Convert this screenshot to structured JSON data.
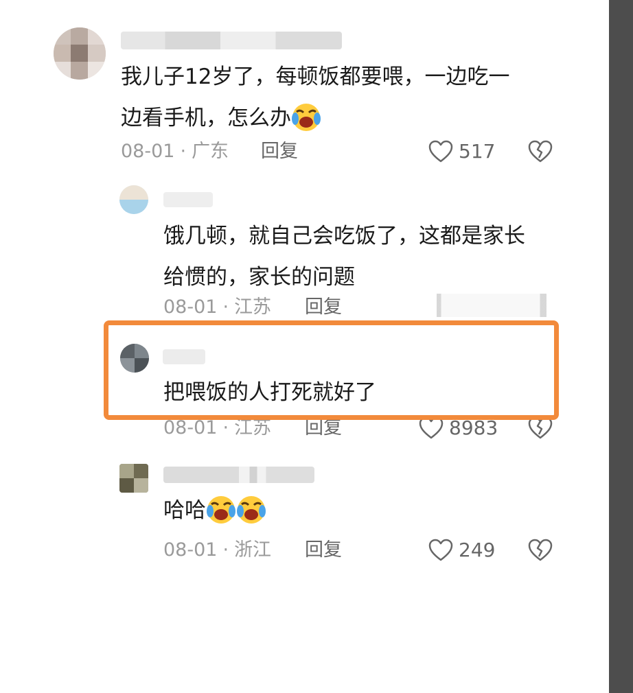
{
  "comments": [
    {
      "text_lines": [
        "我儿子12岁了，每顿饭都要喂，一边吃一",
        "边看手机，怎么办"
      ],
      "date": "08-01",
      "region": "广东",
      "reply_label": "回复",
      "likes": "517"
    },
    {
      "text_lines": [
        "饿几顿，就自己会吃饭了，这都是家长",
        "给惯的，家长的问题"
      ],
      "date": "08-01",
      "region": "江苏",
      "reply_label": "回复"
    },
    {
      "text": "把喂饭的人打死就好了",
      "date": "08-01",
      "region": "江苏",
      "reply_label": "回复",
      "likes": "8983"
    },
    {
      "text": "哈哈",
      "date": "08-01",
      "region": "浙江",
      "reply_label": "回复",
      "likes": "249"
    }
  ],
  "icons": {
    "like": "heart-icon",
    "dislike": "broken-heart-icon",
    "emoji": "laughing-crying-emoji"
  },
  "colors": {
    "highlight_border": "#f28a3b",
    "meta_text": "#9a9a9a",
    "body_text": "#1a1a1a",
    "right_bar": "#4d4d4d"
  }
}
